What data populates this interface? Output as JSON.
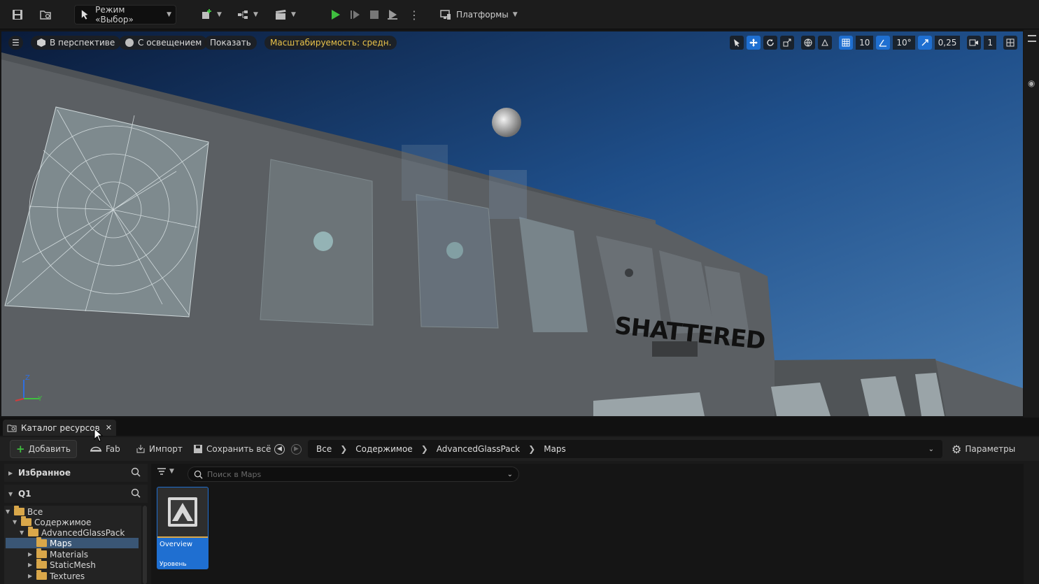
{
  "toolbar": {
    "mode_label": "Режим «Выбор»",
    "platforms_label": "Платформы"
  },
  "viewport": {
    "perspective_label": "В перспективе",
    "lit_label": "С освещением",
    "show_label": "Показать",
    "scalability_label": "Масштабируемость: средн.",
    "grid_snap_value": "10",
    "rotation_snap_value": "10°",
    "scale_snap_value": "0,25",
    "camera_speed_value": "1",
    "scene_text": "SHATTERED",
    "axis_labels": {
      "z": "Z",
      "y": "Y"
    }
  },
  "content_browser": {
    "tab_title": "Каталог ресурсов",
    "add_label": "Добавить",
    "fab_label": "Fab",
    "import_label": "Импорт",
    "save_all_label": "Сохранить всё",
    "breadcrumb": [
      "Все",
      "Содержимое",
      "AdvancedGlassPack",
      "Maps"
    ],
    "settings_label": "Параметры",
    "favorites_label": "Избранное",
    "collection_label": "Q1",
    "search_placeholder": "Поиск в Maps",
    "tree": [
      {
        "label": "Все"
      },
      {
        "label": "Содержимое"
      },
      {
        "label": "AdvancedGlassPack"
      },
      {
        "label": "Maps"
      },
      {
        "label": "Materials"
      },
      {
        "label": "StaticMesh"
      },
      {
        "label": "Textures"
      }
    ],
    "asset": {
      "name": "Overview",
      "type": "Уровень"
    }
  },
  "colors": {
    "accent": "#1f6fd1",
    "folder": "#d9a74a",
    "play": "#3fbf3f",
    "scalability": "#e8c24a"
  }
}
